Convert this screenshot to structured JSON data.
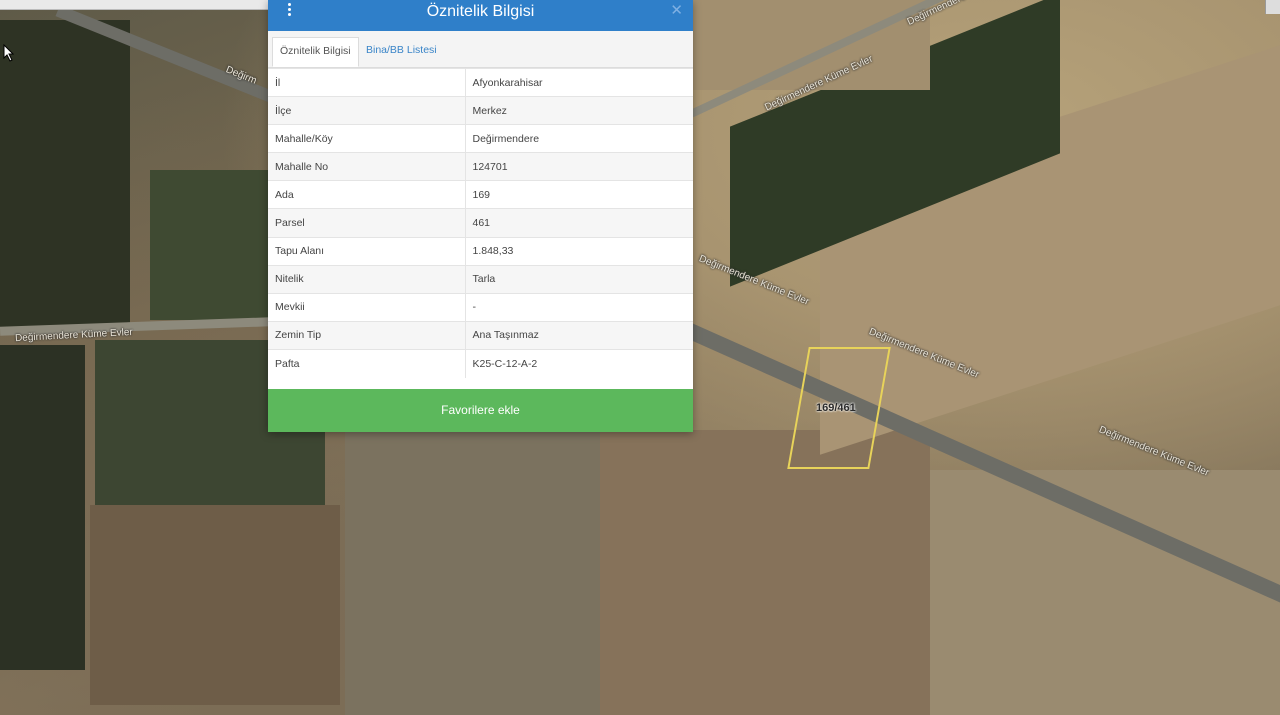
{
  "map": {
    "road_labels": [
      "Değirmendere Küme Evler",
      "Değirmendere Küme Evler",
      "Değirmendere Küme Evler",
      "Değirmendere Küme Evler",
      "Değirmendere Küme Evler",
      "Değirmendere Küme Evler",
      "Değirmendere",
      "Değirm"
    ],
    "parcel_label": "169/461"
  },
  "panel": {
    "title": "Öznitelik Bilgisi",
    "tabs": [
      {
        "label": "Öznitelik Bilgisi",
        "active": true
      },
      {
        "label": "Bina/BB Listesi",
        "active": false
      }
    ],
    "rows": [
      {
        "key": "İl",
        "value": "Afyonkarahisar"
      },
      {
        "key": "İlçe",
        "value": "Merkez"
      },
      {
        "key": "Mahalle/Köy",
        "value": "Değirmendere"
      },
      {
        "key": "Mahalle No",
        "value": "124701"
      },
      {
        "key": "Ada",
        "value": "169"
      },
      {
        "key": "Parsel",
        "value": "461"
      },
      {
        "key": "Tapu Alanı",
        "value": "1.848,33"
      },
      {
        "key": "Nitelik",
        "value": "Tarla"
      },
      {
        "key": "Mevkii",
        "value": "-"
      },
      {
        "key": "Zemin Tip",
        "value": "Ana Taşınmaz"
      },
      {
        "key": "Pafta",
        "value": "K25-C-12-A-2"
      }
    ],
    "favorite_button": "Favorilere ekle"
  },
  "colors": {
    "header": "#2f7fc9",
    "button": "#5cb85c",
    "parcel_outline": "#e8d35a"
  }
}
